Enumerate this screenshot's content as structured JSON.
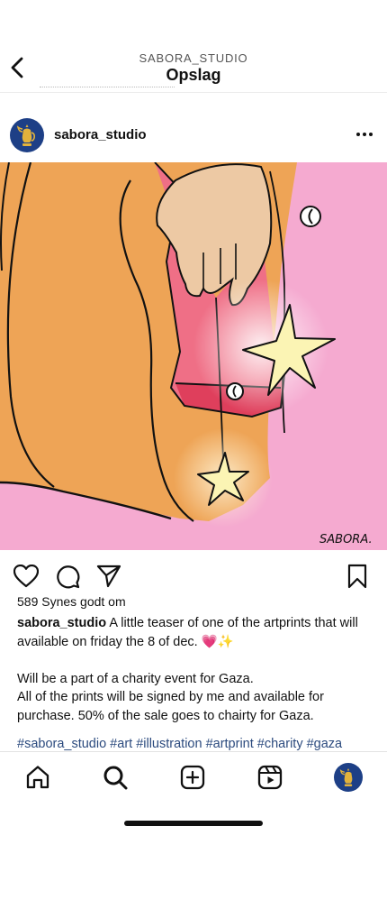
{
  "header": {
    "username": "SABORA_STUDIO",
    "title": "Opslag"
  },
  "post": {
    "username": "sabora_studio",
    "image_signature": "SABORA.",
    "likes": "589 Synes godt om",
    "caption": {
      "user": "sabora_studio",
      "line1": "A little teaser of one of the artprints that will available on friday the 8 of dec. 💗✨",
      "line2": "Will be a part of a charity event for Gaza.",
      "line3": "All of the prints will be signed by me and available for purchase. 50% of the sale goes to chairty for Gaza."
    },
    "hashtags": "#sabora_studio #art #illustration #artprint #charity #gaza"
  },
  "icons": {
    "back": "chevron-left-icon",
    "more": "more-horizontal-icon",
    "like": "heart-icon",
    "comment": "comment-icon",
    "share": "paper-plane-icon",
    "save": "bookmark-icon",
    "home": "home-icon",
    "search": "search-icon",
    "create": "plus-square-icon",
    "reels": "reels-icon",
    "profile": "profile-avatar-icon"
  },
  "colors": {
    "avatar_bg": "#1d3f86",
    "avatar_emblem": "#e2b23c",
    "hashtag": "#2b4a7e",
    "art_pink": "#f4a9cf",
    "art_orange": "#eea456"
  }
}
